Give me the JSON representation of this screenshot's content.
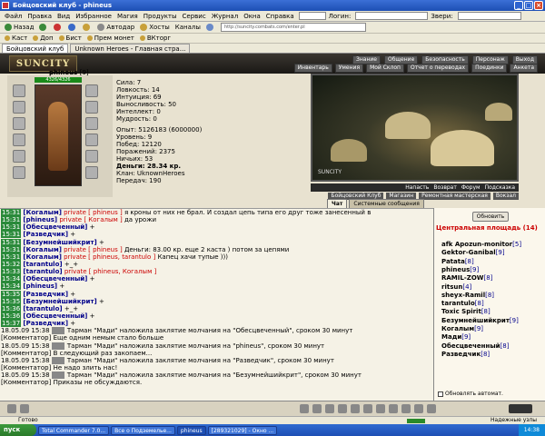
{
  "window": {
    "title": "Бойцовский клуб - phineus"
  },
  "menu": [
    "Файл",
    "Правка",
    "Вид",
    "Избранное",
    "Магия",
    "Продукты",
    "Сервис",
    "Журнал",
    "Окна",
    "Справка"
  ],
  "menu_fields": {
    "login": "Логин:",
    "weather": "Звери:"
  },
  "toolbar": {
    "back": "Назад",
    "autoload": "Автодар",
    "hosts": "Хосты",
    "channels": "Каналы",
    "url": "http://suncity.combats.com/enter.pl"
  },
  "toolbar2": {
    "items": [
      "Каст",
      "Доп",
      "Бист",
      "Прем монет",
      "ВКторг"
    ]
  },
  "tabs": [
    {
      "label": "Бойцовский клуб"
    },
    {
      "label": "Unknown Heroes - Главная стра..."
    }
  ],
  "game": {
    "logo": "SUNCITY",
    "topnav": [
      "Знание",
      "Общение",
      "Безопасность",
      "Персонаж",
      "Выход"
    ],
    "topnav2": [
      "Инвентарь",
      "Умения",
      "Мой Склоп",
      "Отчет о переводах",
      "Поединки",
      "Анкета"
    ],
    "character": {
      "name": "phineus",
      "level": "[9]",
      "hp": "4326/4326"
    },
    "stats": {
      "strength": "Сила: 7",
      "agility": "Ловкость: 14",
      "intuition": "Интуиция: 69",
      "endurance": "Выносливость: 50",
      "intellect": "Интеллект: 0",
      "wisdom": "Мудрость: 0",
      "exp": "Опыт: 5126183 (6000000)",
      "level": "Уровень: 9",
      "wins": "Побед: 12120",
      "losses": "Поражений: 2375",
      "draws": "Ничьих: 53",
      "money": "Деньги: 28.34 кр.",
      "clan": "Клан: UknownHeroes",
      "transfers": "Передач: 190"
    },
    "arena_label": "SUNCITY",
    "arena_nav": [
      "Напасть",
      "Возврат",
      "Форум",
      "Подсказка"
    ],
    "bottom_nav": [
      "Бойцовский Клуб",
      "Магазин",
      "Ремонтная мастерская",
      "Вокзал"
    ],
    "chat_tabs": [
      "Чат",
      "Системные сообщения"
    ]
  },
  "chat": [
    {
      "time": "15:31",
      "text_prefix": "[Когалым]",
      "private": "private [ phineus ]",
      "body": "я кроны от них не брал. И создал цепь типа его друг тоже занесенный в"
    },
    {
      "time": "15:31",
      "text_prefix": "[phineus]",
      "private": "private [ Когалым ]",
      "body": "да урожи"
    },
    {
      "time": "15:31",
      "text_prefix": "[Обесцвеченный]",
      "private": "",
      "body": "+"
    },
    {
      "time": "15:31",
      "text_prefix": "[Разведчик]",
      "private": "",
      "body": "+"
    },
    {
      "time": "15:31",
      "text_prefix": "[Безумнейшийкрит]",
      "private": "",
      "body": "+"
    },
    {
      "time": "15:31",
      "text_prefix": "[Когалым]",
      "private": "private [ phineus ]",
      "body": "Деньги: 83.00 кр. еще 2 каста ) потом за цепями"
    },
    {
      "time": "15:31",
      "text_prefix": "[Когалым]",
      "private": "private [ phineus, tarantulo ]",
      "body": "Капец хачи тупые )))"
    },
    {
      "time": "15:32",
      "text_prefix": "[tarantulo]",
      "private": "",
      "body": "+_+"
    },
    {
      "time": "15:33",
      "text_prefix": "[tarantulo]",
      "private": "private [ phineus, Когалым ]",
      "body": ""
    },
    {
      "time": "15:34",
      "text_prefix": "[Обесцвеченный]",
      "private": "",
      "body": "+"
    },
    {
      "time": "15:34",
      "text_prefix": "[phineus]",
      "private": "",
      "body": "+"
    },
    {
      "time": "15:35",
      "text_prefix": "[Разведчик]",
      "private": "",
      "body": "+"
    },
    {
      "time": "15:35",
      "text_prefix": "[Безумнейшийкрит]",
      "private": "",
      "body": "+"
    },
    {
      "time": "15:36",
      "text_prefix": "[tarantulo]",
      "private": "",
      "body": "+_+"
    },
    {
      "time": "15:36",
      "text_prefix": "[Обесцвеченный]",
      "private": "",
      "body": "+"
    },
    {
      "time": "15:37",
      "text_prefix": "[Разведчик]",
      "private": "",
      "body": "+"
    }
  ],
  "system": [
    {
      "time": "18.05.09 15:38",
      "line1": "Тарман \"Мади\" наложила заклятие молчания на \"Обесцвеченный\", сроком 30 минут",
      "who": "[Комментатор]",
      "line2": "Еще одним немым стало больше"
    },
    {
      "time": "18.05.09 15:38",
      "line1": "Тарман \"Мади\" наложила заклятие молчания на \"phineus\", сроком 30 минут",
      "who": "[Комментатор]",
      "line2": "В следующий раз закопаем..."
    },
    {
      "time": "18.05.09 15:38",
      "line1": "Тарман \"Мади\" наложила заклятие молчания на \"Разведчик\", сроком 30 минут",
      "who": "[Комментатор]",
      "line2": "Не надо злить нас!"
    },
    {
      "time": "18.05.09 15:38",
      "line1": "Тарман \"Мади\" наложила заклятие молчания на \"Безумнейшийкрит\", сроком 30 минут",
      "who": "[Комментатор]",
      "line2": "Приказы не обсуждаются."
    }
  ],
  "room": {
    "refresh": "Обновить",
    "title": "Центральная площадь (14)",
    "users": [
      {
        "name": "afk Apozun-monitor",
        "level": "[5]"
      },
      {
        "name": "Gektor-Ganibal",
        "level": "[9]"
      },
      {
        "name": "Patata",
        "level": "[8]"
      },
      {
        "name": "phineus",
        "level": "[9]"
      },
      {
        "name": "RAMIL-ZOW",
        "level": "[8]"
      },
      {
        "name": "ritsun",
        "level": "[4]"
      },
      {
        "name": "sheyx-Ramil",
        "level": "[8]"
      },
      {
        "name": "tarantulo",
        "level": "[8]"
      },
      {
        "name": "Toxic Spirit",
        "level": "[8]"
      },
      {
        "name": "Безумнейшийкрит",
        "level": "[9]"
      },
      {
        "name": "Когалым",
        "level": "[9]"
      },
      {
        "name": "Мади",
        "level": "[9]"
      },
      {
        "name": "Обесцвеченный",
        "level": "[8]"
      },
      {
        "name": "Разведчик",
        "level": "[8]"
      }
    ],
    "auto": "Обновлять автомат."
  },
  "statusbar": {
    "text": "Готово",
    "zone": "Надежные узлы"
  },
  "taskbar": {
    "start": "пуск",
    "tasks": [
      "Total Commander 7.0...",
      "Все о Подземелье...",
      "phineus",
      "[289321029] - Окно ..."
    ],
    "clock": "14:38"
  }
}
